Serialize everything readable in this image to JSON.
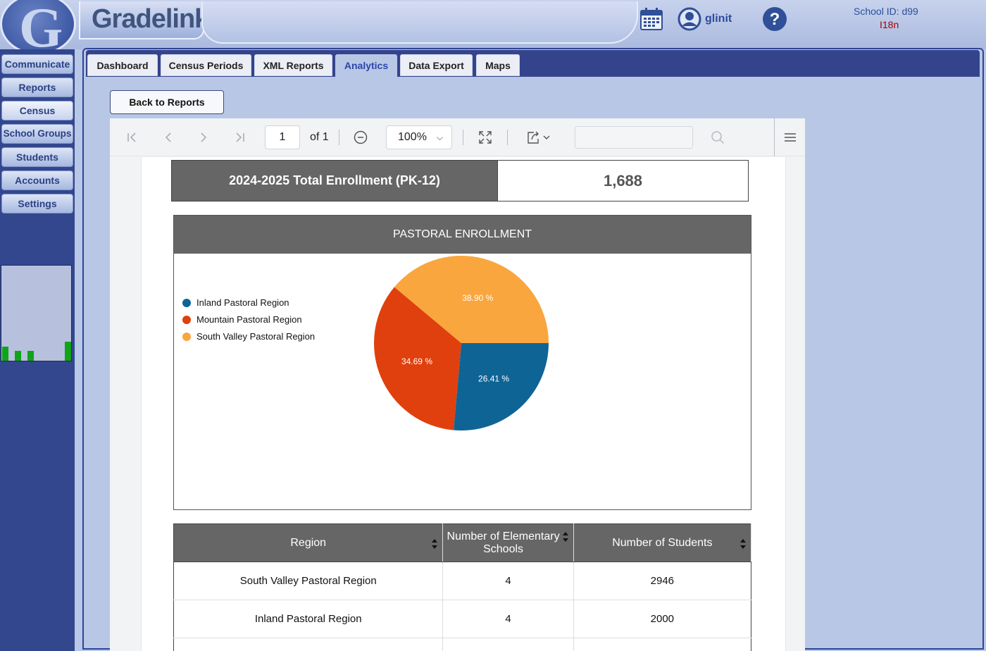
{
  "header": {
    "brand": "Gradelink",
    "username": "glinit",
    "school_id_label": "School ID:  d99",
    "locale": "I18n"
  },
  "sidebar": {
    "items": [
      {
        "label": "Communicate"
      },
      {
        "label": "Reports"
      },
      {
        "label": "Census"
      },
      {
        "label": "School Groups"
      },
      {
        "label": "Students"
      },
      {
        "label": "Accounts"
      },
      {
        "label": "Settings"
      }
    ],
    "active": "Census"
  },
  "tabs": [
    {
      "label": "Dashboard"
    },
    {
      "label": "Census Periods"
    },
    {
      "label": "XML Reports"
    },
    {
      "label": "Analytics"
    },
    {
      "label": "Data Export"
    },
    {
      "label": "Maps"
    }
  ],
  "active_tab": "Analytics",
  "back_button": "Back to Reports",
  "viewer": {
    "page": "1",
    "of_label": "of 1",
    "zoom": "100%",
    "search_placeholder": ""
  },
  "report": {
    "enrollment_label": "2024-2025 Total Enrollment (PK-12)",
    "enrollment_value": "1,688"
  },
  "chart_data": {
    "type": "pie",
    "title": "PASTORAL ENROLLMENT",
    "legend_position": "left",
    "labels": [
      "Inland Pastoral Region",
      "Mountain Pastoral Region",
      "South Valley Pastoral Region"
    ],
    "values": [
      26.41,
      34.69,
      38.9
    ],
    "value_labels": [
      "26.41 %",
      "34.69 %",
      "38.90 %"
    ],
    "colors": [
      "#0f6496",
      "#e0400d",
      "#f9a63f"
    ]
  },
  "table": {
    "headers": [
      "Region",
      "Number of Elementary Schools",
      "Number of Students"
    ],
    "rows": [
      [
        "South Valley Pastoral Region",
        "4",
        "2946"
      ],
      [
        "Inland Pastoral Region",
        "4",
        "2000"
      ]
    ]
  },
  "colors": {
    "nav_blue": "#33478f",
    "panel_bg": "#b8c7e6",
    "report_header_gray": "#666666"
  }
}
